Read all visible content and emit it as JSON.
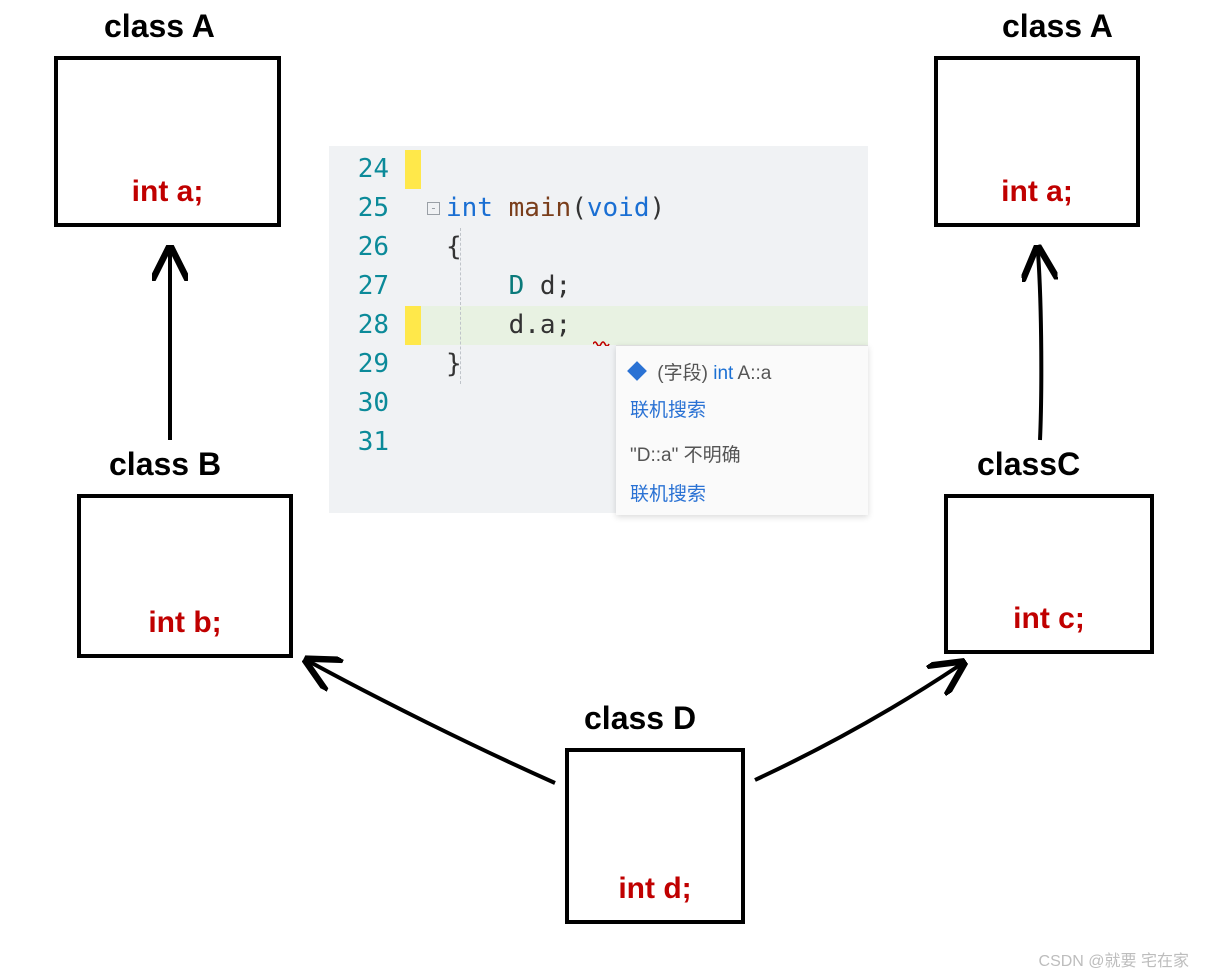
{
  "classes": {
    "a1": {
      "label": "class A",
      "member": "int a;"
    },
    "a2": {
      "label": "class A",
      "member": "int a;"
    },
    "b": {
      "label": "class B",
      "member": "int b;"
    },
    "c": {
      "label": "classC",
      "member": "int c;"
    },
    "d": {
      "label": "class D",
      "member": "int d;"
    }
  },
  "code": {
    "lines": [
      "24",
      "25",
      "26",
      "27",
      "28",
      "29",
      "30",
      "31"
    ],
    "l25_int": "int ",
    "l25_main": "main",
    "l25_open": "(",
    "l25_void": "void",
    "l25_close": ")",
    "l26": "{",
    "l27_type": "D ",
    "l27_rest": "d;",
    "l28": "d.a;",
    "l29": "}"
  },
  "tooltip": {
    "field_segment": "(字段) ",
    "field_type": "int ",
    "field_name": "A::a",
    "search": "联机搜索",
    "error": "\"D::a\" 不明确",
    "search2": "联机搜索"
  },
  "watermark": "CSDN @就要 宅在家"
}
